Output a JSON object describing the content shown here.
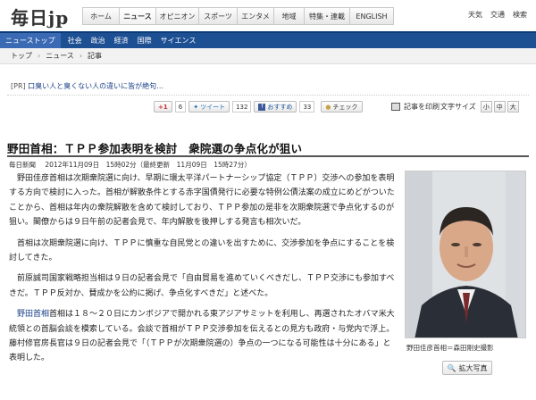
{
  "header": {
    "logo": "毎日jp",
    "global_nav": [
      "ホーム",
      "ニュース",
      "オピニオン",
      "スポーツ",
      "エンタメ",
      "地域",
      "特集・連載",
      "ENGLISH"
    ],
    "active_nav": "ニュース",
    "top_links": [
      "天気",
      "交通",
      "検索"
    ]
  },
  "subnav": {
    "items": [
      "ニューストップ",
      "社会",
      "政治",
      "経済",
      "国際",
      "サイエンス"
    ]
  },
  "breadcrumb": {
    "items": [
      "トップ",
      "ニュース",
      "記事"
    ]
  },
  "pr": {
    "tag": "[PR]",
    "text": "口臭い人と臭くない人の違いに皆が絶句…"
  },
  "share": {
    "gplus_label": "+1",
    "gplus_count": "6",
    "tweet_label": "ツイート",
    "tweet_count": "132",
    "osusume_label": "おすすめ",
    "osusume_count": "33",
    "check_label": "チェック",
    "print_label": "記事を印刷",
    "font_size_label": "文字サイズ",
    "font_sizes": [
      "小",
      "中",
      "大"
    ]
  },
  "article": {
    "title": "野田首相：ＴＰＰ参加表明を検討　衆院選の争点化が狙い",
    "source": "毎日新聞",
    "date": "2012年11月09日　15時02分（最終更新　11月09日　15時27分）",
    "paragraphs": [
      "野田佳彦首相は次期衆院選に向け、早期に環太平洋パートナーシップ協定（ＴＰＰ）交渉への参加を表明する方向で検討に入った。首相が解散条件とする赤字国債発行に必要な特例公債法案の成立にめどがついたことから、首相は年内の衆院解散を含めて検討しており、ＴＰＰ参加の是非を次期衆院選で争点化するのが狙い。閣僚からは９日午前の記者会見で、年内解散を後押しする発言も相次いだ。",
      "首相は次期衆院選に向け、ＴＰＰに慎重な自民党との違いを出すために、交渉参加を争点にすることを検討してきた。",
      "前原誠司国家戦略担当相は９日の記者会見で「自由貿易を進めていくべきだし、ＴＰＰ交渉にも参加すべきだ。ＴＰＰ反対か、賛成かを公約に掲げ、争点化すべきだ」と述べた。",
      "首相は１８～２０日にカンボジアで開かれる東アジアサミットを利用し、再選されたオバマ米大統領との首脳会談を模索している。会談で首相がＴＰＰ交渉参加を伝えるとの見方も政府・与党内で浮上。藤村修官房長官は９日の記者会見で「（ＴＰＰが次期衆院選の）争点の一つになる可能性は十分にある」と表明した。"
    ],
    "highlight_prefix": "野田首相"
  },
  "photo": {
    "caption": "野田佳彦首相＝森田剛史撮影",
    "zoom_label": "拡大写真"
  }
}
